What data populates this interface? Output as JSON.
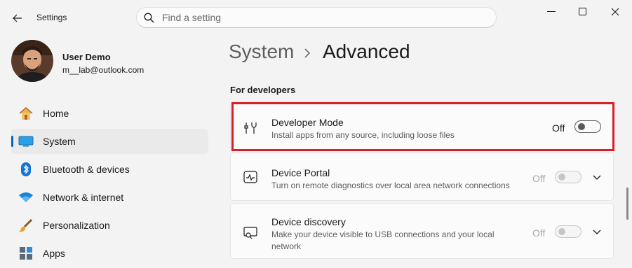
{
  "app": {
    "title": "Settings"
  },
  "search": {
    "placeholder": "Find a setting"
  },
  "user": {
    "name": "User Demo",
    "email": "m__lab@outlook.com"
  },
  "nav": {
    "items": [
      {
        "label": "Home",
        "icon": "home-icon"
      },
      {
        "label": "System",
        "icon": "system-icon",
        "selected": true
      },
      {
        "label": "Bluetooth & devices",
        "icon": "bluetooth-icon"
      },
      {
        "label": "Network & internet",
        "icon": "wifi-icon"
      },
      {
        "label": "Personalization",
        "icon": "brush-icon"
      },
      {
        "label": "Apps",
        "icon": "apps-icon"
      }
    ]
  },
  "breadcrumb": {
    "parent": "System",
    "current": "Advanced"
  },
  "section": {
    "title": "For developers"
  },
  "settings": [
    {
      "title": "Developer Mode",
      "description": "Install apps from any source, including loose files",
      "state": "Off",
      "enabled": true,
      "icon": "developer-tools-icon"
    },
    {
      "title": "Device Portal",
      "description": "Turn on remote diagnostics over local area network connections",
      "state": "Off",
      "enabled": false,
      "icon": "pulse-icon"
    },
    {
      "title": "Device discovery",
      "description": "Make your device visible to USB connections and your local network",
      "state": "Off",
      "enabled": false,
      "icon": "device-search-icon"
    }
  ],
  "colors": {
    "accent": "#0067c0",
    "highlight": "#d9202a",
    "background": "#f3f3f3",
    "card": "#fbfbfb"
  }
}
